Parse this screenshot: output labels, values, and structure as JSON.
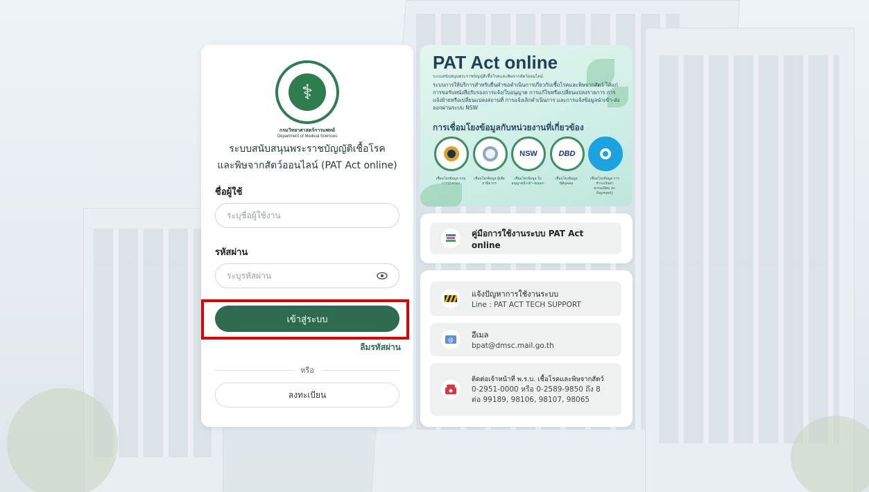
{
  "login": {
    "dept_th": "กรมวิทยาศาสตร์การแพทย์",
    "dept_en": "Department of Medical Sciences",
    "title_line1": "ระบบสนับสนุนพระราชบัญญัติเชื้อโรค",
    "title_line2": "และพิษจากสัตว์ออนไลน์ (PAT Act online)",
    "username_label": "ชื่อผู้ใช้",
    "username_placeholder": "ระบุชื่อผู้ใช้งาน",
    "password_label": "รหัสผ่าน",
    "password_placeholder": "ระบุรหัสผ่าน",
    "login_button": "เข้าสู่ระบบ",
    "forgot_password": "ลืมรหัสผ่าน",
    "or": "หรือ",
    "register_button": "ลงทะเบียน"
  },
  "banner": {
    "title": "PAT Act online",
    "subtitle": "ระบบสนับสนุนพระราชบัญญัติเชื้อโรคและพิษจากสัตว์ออนไลน์",
    "description": "ระบบการให้บริการสำหรับยื่นคำขอดำเนินการเกี่ยวกับเชื้อโรคและพิษจากสัตว์ ได้แก่ การขอรับหนังสือรับรองการแจ้ง/ใบอนุญาต การแก้ไขหรือเปลี่ยนแปลงรายการ การแจ้งย้ายหรือเปลี่ยนแปลงสถานที่ การแจ้งเลิกดำเนินการ และการแจ้งข้อมูลนำเข้า-ส่งออกผ่านระบบ NSW",
    "link_title": "การเชื่อมโยงข้อมูลกับหน่วยงานที่เกี่ยวข้อง",
    "orgs": [
      {
        "logo": "",
        "caption": "เชื่อมโยงข้อมูล กรมการปกครอง"
      },
      {
        "logo": "",
        "caption": "เชื่อมโยงข้อมูล ผู้เสียภาษีอากร"
      },
      {
        "logo": "NSW",
        "caption": "เชื่อมโยงข้อมูล ใบอนุญาตนำเข้า-ส่งออก"
      },
      {
        "logo": "DBD",
        "caption": "เชื่อมโยงข้อมูล นิติบุคคล"
      },
      {
        "logo": "",
        "caption": "เชื่อมโยงข้อมูล การชำระเงินค่าธรรมเนียม (e-Payment)"
      }
    ]
  },
  "manual": {
    "label": "คู่มือการใช้งานระบบ PAT Act online"
  },
  "contacts": {
    "support_title": "แจ้งปัญหาการใช้งานระบบ",
    "support_sub": "Line : PAT ACT TECH SUPPORT",
    "email_title": "อีเมล",
    "email_sub": "bpat@dmsc.mail.go.th",
    "phone_title": "ติดต่อเจ้าหน้าที่ พ.ร.บ. เชื้อโรคและพิษจากสัตว์",
    "phone_line1": "0-2951-0000 หรือ 0-2589-9850 ถึง 8",
    "phone_line2": "ต่อ 99189, 98106, 98107, 98065"
  },
  "colors": {
    "primary": "#2d6a4f",
    "highlight": "#e00000"
  }
}
